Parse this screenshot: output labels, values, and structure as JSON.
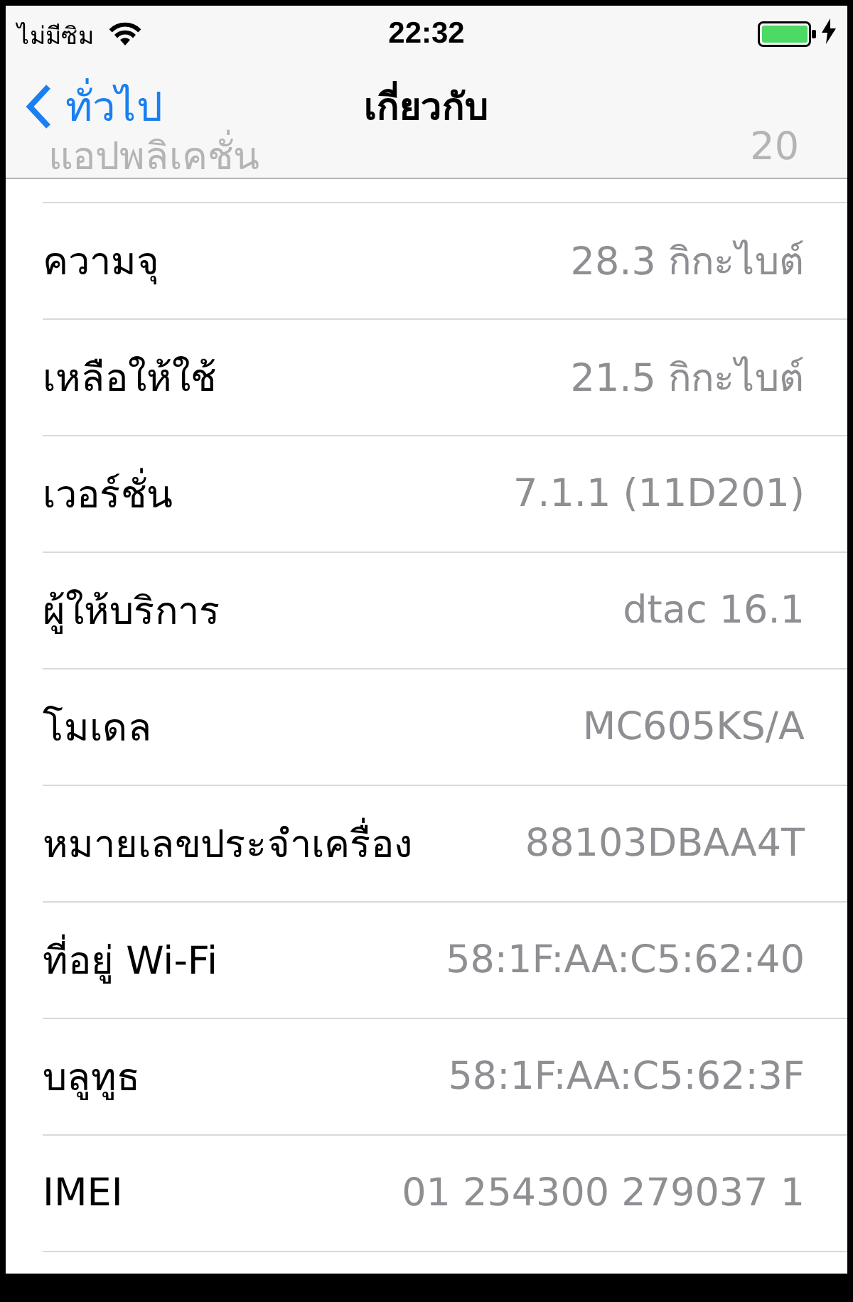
{
  "status_bar": {
    "carrier": "ไม่มีซิม",
    "time": "22:32",
    "charging": true
  },
  "nav_bar": {
    "back": "ทั่วไป",
    "title": "เกี่ยวกับ"
  },
  "scrolled_row": {
    "label": "แอปพลิเคชั่น",
    "value": "20"
  },
  "rows": [
    {
      "label": "ความจุ",
      "value": "28.3 กิกะไบต์"
    },
    {
      "label": "เหลือให้ใช้",
      "value": "21.5 กิกะไบต์"
    },
    {
      "label": "เวอร์ชั่น",
      "value": "7.1.1 (11D201)"
    },
    {
      "label": "ผู้ให้บริการ",
      "value": "dtac 16.1"
    },
    {
      "label": "โมเดล",
      "value": "MC605KS/A"
    },
    {
      "label": "หมายเลขประจำเครื่อง",
      "value": "88103DBAA4T"
    },
    {
      "label": "ที่อยู่ Wi-Fi",
      "value": "58:1F:AA:C5:62:40"
    },
    {
      "label": "บลูทูธ",
      "value": "58:1F:AA:C5:62:3F"
    },
    {
      "label": "IMEI",
      "value": "01 254300 279037 1"
    }
  ]
}
